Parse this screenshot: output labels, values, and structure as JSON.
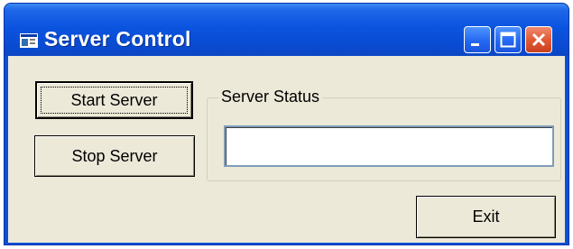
{
  "window": {
    "title": "Server Control",
    "controls": {
      "minimize": "minimize-icon",
      "maximize": "maximize-icon",
      "close": "close-icon"
    },
    "colors": {
      "titlebar": "#0a54df",
      "client_background": "#ece9d8",
      "close_button": "#e25a35"
    }
  },
  "buttons": {
    "start_label": "Start Server",
    "stop_label": "Stop Server",
    "exit_label": "Exit"
  },
  "server_status": {
    "legend": "Server Status",
    "value": ""
  }
}
